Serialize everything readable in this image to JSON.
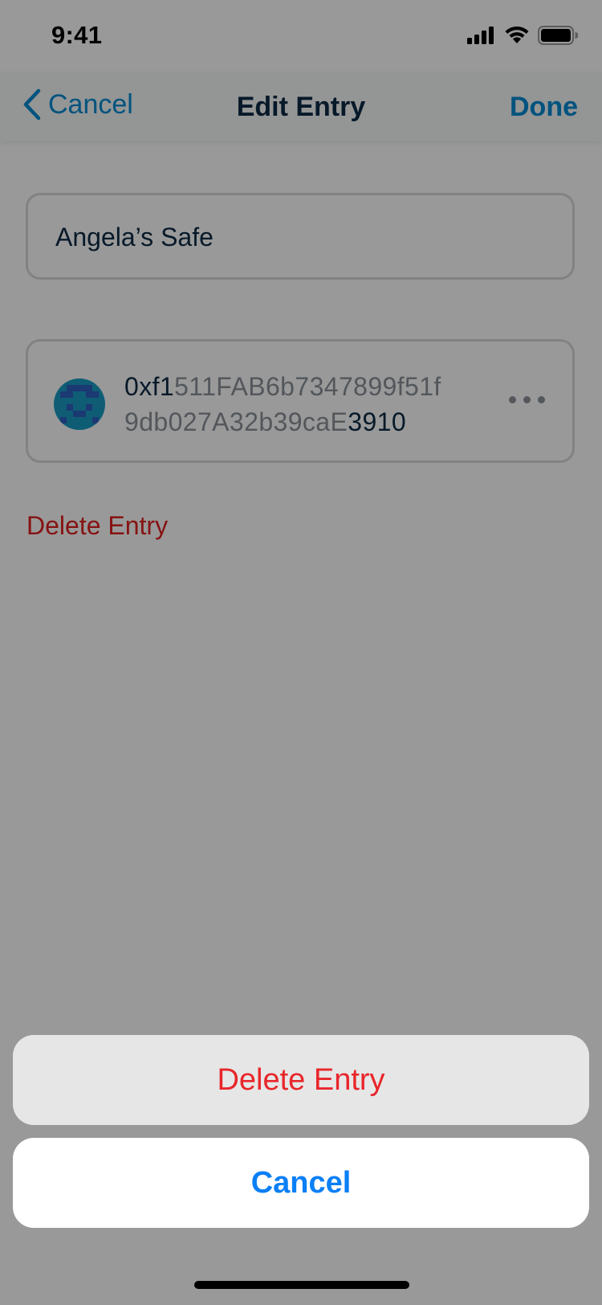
{
  "status_bar": {
    "time": "9:41"
  },
  "nav": {
    "back_label": "Cancel",
    "title": "Edit Entry",
    "done_label": "Done"
  },
  "entry": {
    "name": "Angela’s Safe",
    "address": {
      "line1_prefix": "0xf1",
      "line1_rest": "511FAB6b7347899f51f",
      "line2_rest": "9db027A32b39caE",
      "line2_suffix": "3910"
    }
  },
  "delete_link_label": "Delete Entry",
  "action_sheet": {
    "delete_label": "Delete Entry",
    "cancel_label": "Cancel"
  },
  "colors": {
    "accent": "#008bd3",
    "destructive": "#e8262b",
    "system_blue": "#0a7ff6"
  }
}
